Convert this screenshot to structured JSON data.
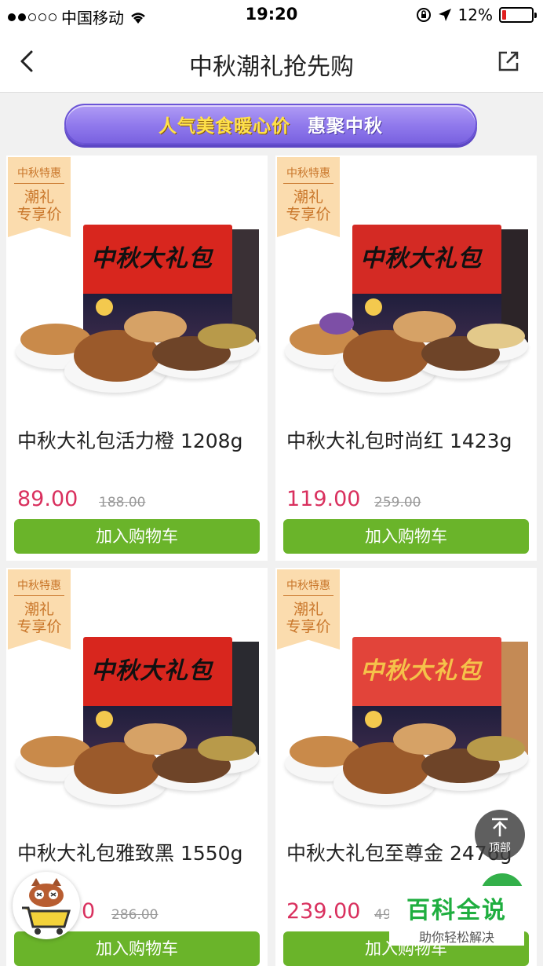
{
  "status_bar": {
    "carrier": "中国移动",
    "time": "19:20",
    "battery": "12%",
    "battery_level": 0.12
  },
  "nav": {
    "title": "中秋潮礼抢先购"
  },
  "banner": {
    "left_text": "人气美食暖心价",
    "right_text": "惠聚中秋"
  },
  "tag": {
    "line1": "中秋特惠",
    "line2": "潮礼",
    "line3": "专享价"
  },
  "box_title": "中秋大礼包",
  "products": [
    {
      "name": "中秋大礼包活力橙 1208g",
      "price": "89.00",
      "old_price": "188.00",
      "button": "加入购物车"
    },
    {
      "name": "中秋大礼包时尚红 1423g",
      "price": "119.00",
      "old_price": "259.00",
      "button": "加入购物车"
    },
    {
      "name": "中秋大礼包雅致黑 1550g",
      "price": "0",
      "old_price": "286.00",
      "button": "加入购物车"
    },
    {
      "name": "中秋大礼包至尊金 2476g",
      "price": "239.00",
      "old_price": "49",
      "button": "加入购物车"
    }
  ],
  "back_to_top": "顶部",
  "watermark": {
    "title": "百科全说",
    "subtitle": "助你轻松解决"
  },
  "colors": {
    "price": "#d9305e",
    "cart_button": "#6ab42a",
    "banner": "#8f78ec"
  }
}
